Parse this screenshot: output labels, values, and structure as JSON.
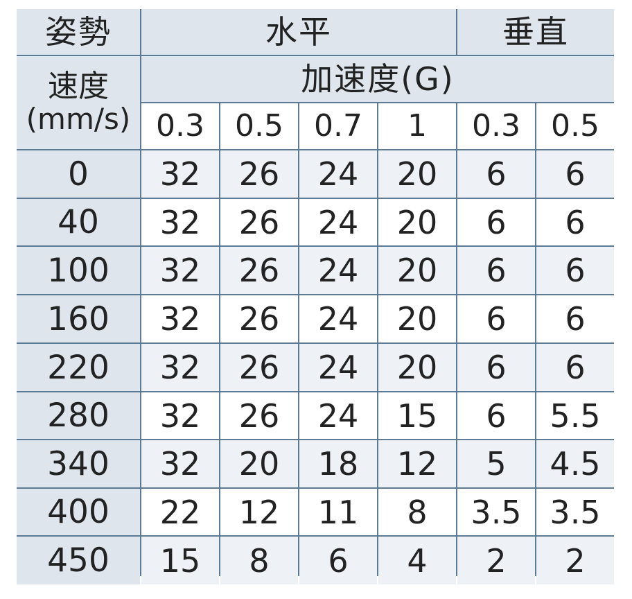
{
  "headers": {
    "posture": "姿勢",
    "horizontal": "水平",
    "vertical": "垂直",
    "speed": "速度",
    "speed_unit": "(mm/s)",
    "acceleration": "加速度(G)",
    "accelerations": [
      "0.3",
      "0.5",
      "0.7",
      "1",
      "0.3",
      "0.5"
    ]
  },
  "rows": [
    {
      "speed": "0",
      "values": [
        "32",
        "26",
        "24",
        "20",
        "6",
        "6"
      ]
    },
    {
      "speed": "40",
      "values": [
        "32",
        "26",
        "24",
        "20",
        "6",
        "6"
      ]
    },
    {
      "speed": "100",
      "values": [
        "32",
        "26",
        "24",
        "20",
        "6",
        "6"
      ]
    },
    {
      "speed": "160",
      "values": [
        "32",
        "26",
        "24",
        "20",
        "6",
        "6"
      ]
    },
    {
      "speed": "220",
      "values": [
        "32",
        "26",
        "24",
        "20",
        "6",
        "6"
      ]
    },
    {
      "speed": "280",
      "values": [
        "32",
        "26",
        "24",
        "15",
        "6",
        "5.5"
      ]
    },
    {
      "speed": "340",
      "values": [
        "32",
        "20",
        "18",
        "12",
        "5",
        "4.5"
      ]
    },
    {
      "speed": "400",
      "values": [
        "22",
        "12",
        "11",
        "8",
        "3.5",
        "3.5"
      ]
    },
    {
      "speed": "450",
      "values": [
        "15",
        "8",
        "6",
        "4",
        "2",
        "2"
      ]
    }
  ],
  "colors": {
    "border": "#5c7a93",
    "header_bg": "#dfe5ec",
    "alt_row_bg": "#eef2f6",
    "text": "#222222"
  }
}
